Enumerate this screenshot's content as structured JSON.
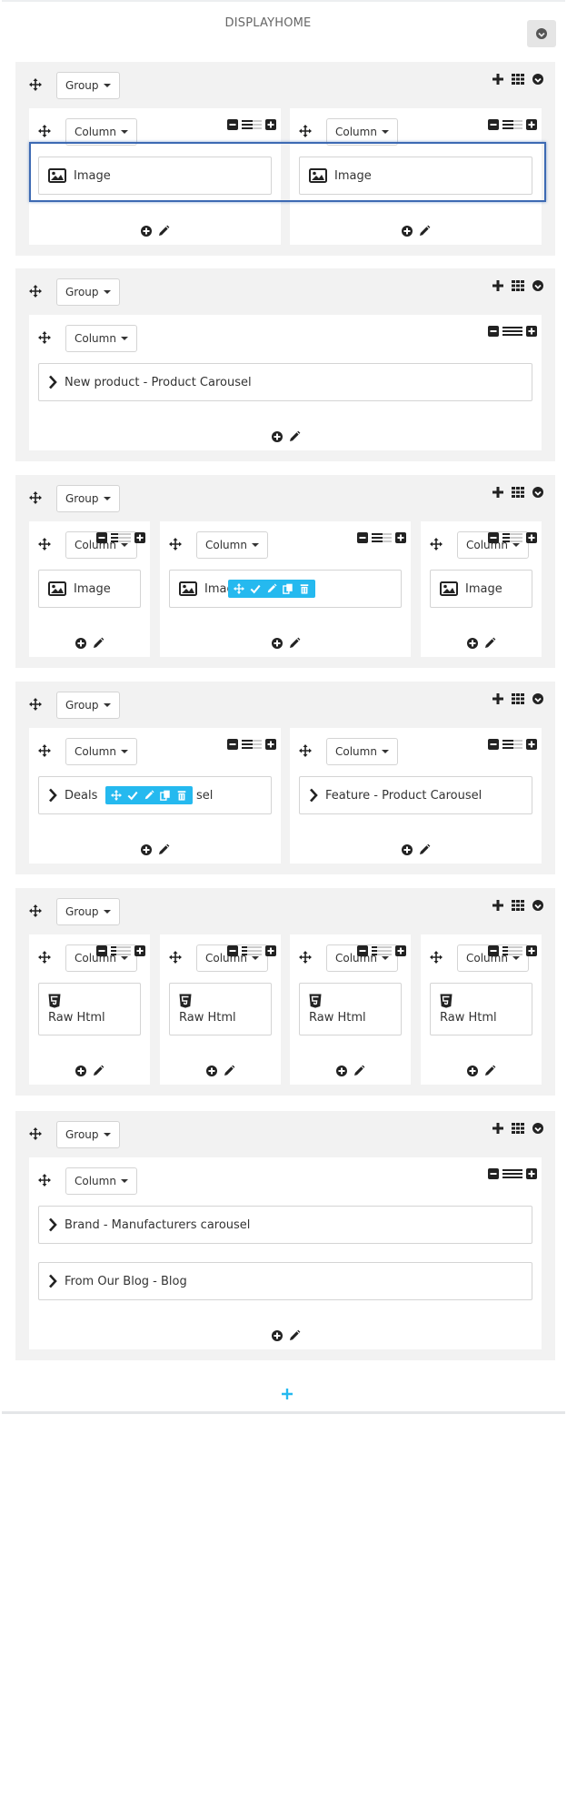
{
  "hook": {
    "title": "DISPLAYHOME"
  },
  "labels": {
    "group": "Group",
    "column": "Column"
  },
  "groups": [
    {
      "columns": [
        {
          "items": [
            {
              "type": "image",
              "label": "Image"
            }
          ]
        },
        {
          "items": [
            {
              "type": "image",
              "label": "Image"
            }
          ]
        }
      ]
    },
    {
      "columns": [
        {
          "items": [
            {
              "type": "module",
              "label": "New product - Product Carousel"
            }
          ]
        }
      ]
    },
    {
      "columns": [
        {
          "items": [
            {
              "type": "image",
              "label": "Image"
            }
          ]
        },
        {
          "items": [
            {
              "type": "image",
              "label": "Imag"
            }
          ]
        },
        {
          "items": [
            {
              "type": "image",
              "label": "Image"
            }
          ]
        }
      ]
    },
    {
      "columns": [
        {
          "items": [
            {
              "type": "module",
              "label": "Deals",
              "label_tail": "sel"
            }
          ]
        },
        {
          "items": [
            {
              "type": "module",
              "label": "Feature - Product Carousel"
            }
          ]
        }
      ]
    },
    {
      "columns": [
        {
          "items": [
            {
              "type": "html",
              "label": "Raw Html"
            }
          ]
        },
        {
          "items": [
            {
              "type": "html",
              "label": "Raw Html"
            }
          ]
        },
        {
          "items": [
            {
              "type": "html",
              "label": "Raw Html"
            }
          ]
        },
        {
          "items": [
            {
              "type": "html",
              "label": "Raw Html"
            }
          ]
        }
      ]
    },
    {
      "columns": [
        {
          "items": [
            {
              "type": "module",
              "label": "Brand - Manufacturers carousel"
            },
            {
              "type": "module",
              "label": "From Our Blog - Blog"
            }
          ]
        }
      ]
    }
  ],
  "icons": {
    "move": "move-icon",
    "plus": "plus-icon",
    "grid": "grid-icon",
    "collapse": "circle-arrow-down-icon",
    "minus": "minus-square-icon",
    "size": "size-bars-icon",
    "add": "plus-circle-icon",
    "edit": "pencil-icon",
    "image": "image-icon",
    "chevron": "chevron-right-icon",
    "html5": "html5-icon",
    "check": "check-icon",
    "copy": "copy-icon",
    "trash": "trash-icon"
  },
  "colors": {
    "accent": "#25b9ef",
    "selection": "#3d6ab3",
    "panel": "#f2f2f2"
  }
}
